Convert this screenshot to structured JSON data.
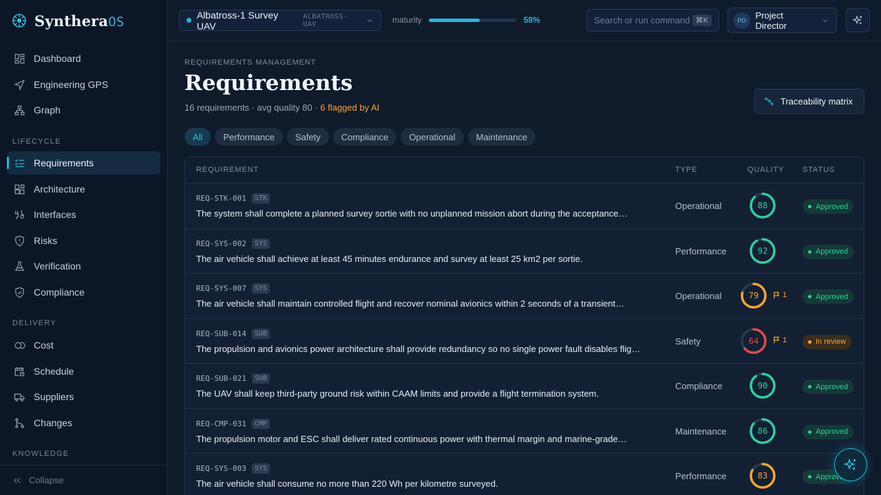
{
  "brand": {
    "name": "Synthera",
    "suffix": "OS"
  },
  "sidebar": {
    "top_items": [
      {
        "label": "Dashboard",
        "icon": "dashboard-icon"
      },
      {
        "label": "Engineering GPS",
        "icon": "navigation-icon"
      },
      {
        "label": "Graph",
        "icon": "graph-icon"
      }
    ],
    "sections": [
      {
        "title": "LIFECYCLE",
        "items": [
          {
            "label": "Requirements",
            "icon": "checklist-icon",
            "active": true
          },
          {
            "label": "Architecture",
            "icon": "architecture-icon"
          },
          {
            "label": "Interfaces",
            "icon": "interfaces-icon"
          },
          {
            "label": "Risks",
            "icon": "risk-shield-icon"
          },
          {
            "label": "Verification",
            "icon": "flask-icon"
          },
          {
            "label": "Compliance",
            "icon": "shield-check-icon"
          }
        ]
      },
      {
        "title": "DELIVERY",
        "items": [
          {
            "label": "Cost",
            "icon": "coins-icon"
          },
          {
            "label": "Schedule",
            "icon": "calendar-clock-icon"
          },
          {
            "label": "Suppliers",
            "icon": "truck-icon"
          },
          {
            "label": "Changes",
            "icon": "git-branch-icon"
          }
        ]
      },
      {
        "title": "KNOWLEDGE",
        "items": []
      }
    ],
    "collapse_label": "Collapse"
  },
  "topbar": {
    "project_name": "Albatross-1 Survey UAV",
    "project_code": "ALBATROSS-UAV",
    "maturity_label": "maturity",
    "maturity_value": "58%",
    "maturity_fraction": 0.58,
    "search_placeholder": "Search or run command",
    "search_shortcut": "⌘K",
    "user_initials": "PD",
    "user_role": "Project Director"
  },
  "page": {
    "breadcrumb": "REQUIREMENTS MANAGEMENT",
    "title": "Requirements",
    "summary": "16 requirements · avg quality 80 · ",
    "flagged": "6 flagged by AI",
    "trace_button": "Traceability matrix",
    "filters": [
      "All",
      "Performance",
      "Safety",
      "Compliance",
      "Operational",
      "Maintenance"
    ],
    "active_filter": "All"
  },
  "table": {
    "headers": {
      "requirement": "REQUIREMENT",
      "type": "TYPE",
      "quality": "QUALITY",
      "status": "STATUS"
    },
    "rows": [
      {
        "id": "REQ-STK-001",
        "level": "STK",
        "text": "The system shall complete a planned survey sortie with no unplanned mission abort during the acceptance…",
        "type": "Operational",
        "quality": 88,
        "flags": "",
        "status": "Approved"
      },
      {
        "id": "REQ-SYS-002",
        "level": "SYS",
        "text": "The air vehicle shall achieve at least 45 minutes endurance and survey at least 25 km2 per sortie.",
        "type": "Performance",
        "quality": 92,
        "flags": "",
        "status": "Approved"
      },
      {
        "id": "REQ-SYS-007",
        "level": "SYS",
        "text": "The air vehicle shall maintain controlled flight and recover nominal avionics within 2 seconds of a transient…",
        "type": "Operational",
        "quality": 79,
        "flags": "1",
        "status": "Approved"
      },
      {
        "id": "REQ-SUB-014",
        "level": "SUB",
        "text": "The propulsion and avionics power architecture shall provide redundancy so no single power fault disables flig…",
        "type": "Safety",
        "quality": 64,
        "flags": "1",
        "status": "In review"
      },
      {
        "id": "REQ-SUB-021",
        "level": "SUB",
        "text": "The UAV shall keep third-party ground risk within CAAM limits and provide a flight termination system.",
        "type": "Compliance",
        "quality": 90,
        "flags": "",
        "status": "Approved"
      },
      {
        "id": "REQ-CMP-031",
        "level": "CMP",
        "text": "The propulsion motor and ESC shall deliver rated continuous power with thermal margin and marine-grade…",
        "type": "Maintenance",
        "quality": 86,
        "flags": "",
        "status": "Approved"
      },
      {
        "id": "REQ-SYS-003",
        "level": "SYS",
        "text": "The air vehicle shall consume no more than 220 Wh per kilometre surveyed.",
        "type": "Performance",
        "quality": 83,
        "flags": "",
        "status": "Approved"
      }
    ]
  },
  "colors": {
    "accent": "#22b8d6",
    "good": "#2fce9b",
    "warn": "#f2a531",
    "bad": "#e5484d"
  }
}
